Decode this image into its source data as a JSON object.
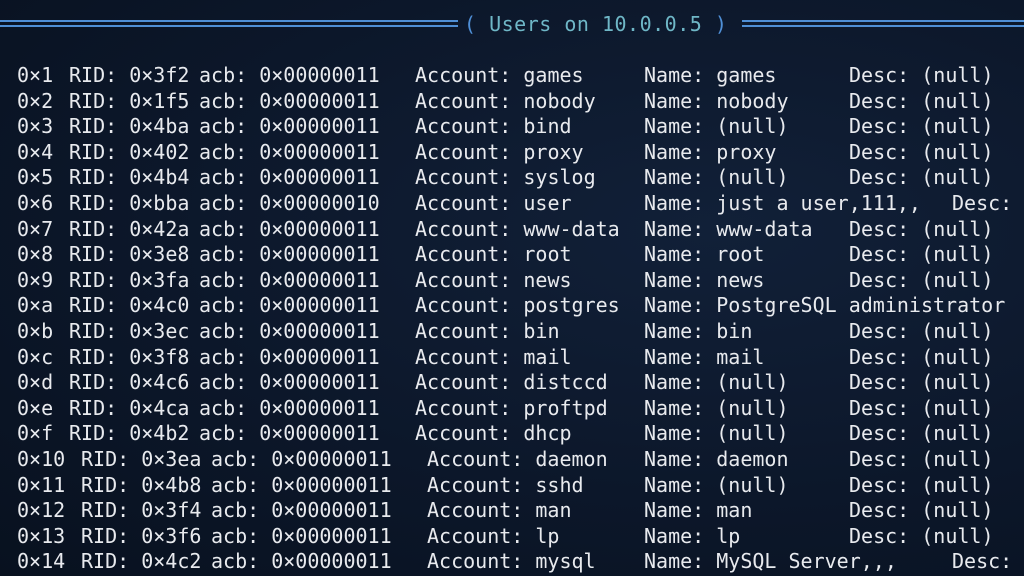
{
  "header": {
    "title": "Users on 10.0.0.5",
    "open": "(",
    "close": ")"
  },
  "rows": [
    {
      "idx": "0×1",
      "rid": "RID: 0×3f2",
      "acb": "acb: 0×00000011",
      "account": "Account: games",
      "name": "Name: games",
      "desc": "Desc: (null)"
    },
    {
      "idx": "0×2",
      "rid": "RID: 0×1f5",
      "acb": "acb: 0×00000011",
      "account": "Account: nobody",
      "name": "Name: nobody",
      "desc": "Desc: (null)"
    },
    {
      "idx": "0×3",
      "rid": "RID: 0×4ba",
      "acb": "acb: 0×00000011",
      "account": "Account: bind",
      "name": "Name: (null)",
      "desc": "Desc: (null)"
    },
    {
      "idx": "0×4",
      "rid": "RID: 0×402",
      "acb": "acb: 0×00000011",
      "account": "Account: proxy",
      "name": "Name: proxy",
      "desc": "Desc: (null)"
    },
    {
      "idx": "0×5",
      "rid": "RID: 0×4b4",
      "acb": "acb: 0×00000011",
      "account": "Account: syslog",
      "name": "Name: (null)",
      "desc": "Desc: (null)"
    },
    {
      "idx": "0×6",
      "rid": "RID: 0×bba",
      "acb": "acb: 0×00000010",
      "account": "Account: user",
      "name": "Name: just a user,111,,",
      "desc": "Desc:"
    },
    {
      "idx": "0×7",
      "rid": "RID: 0×42a",
      "acb": "acb: 0×00000011",
      "account": "Account: www-data",
      "name": "Name: www-data",
      "desc": "Desc: (null)"
    },
    {
      "idx": "0×8",
      "rid": "RID: 0×3e8",
      "acb": "acb: 0×00000011",
      "account": "Account: root",
      "name": "Name: root",
      "desc": "Desc: (null)"
    },
    {
      "idx": "0×9",
      "rid": "RID: 0×3fa",
      "acb": "acb: 0×00000011",
      "account": "Account: news",
      "name": "Name: news",
      "desc": "Desc: (null)"
    },
    {
      "idx": "0×a",
      "rid": "RID: 0×4c0",
      "acb": "acb: 0×00000011",
      "account": "Account: postgres",
      "name": "Name: PostgreSQL administrator",
      "desc": ""
    },
    {
      "idx": "0×b",
      "rid": "RID: 0×3ec",
      "acb": "acb: 0×00000011",
      "account": "Account: bin",
      "name": "Name: bin",
      "desc": "Desc: (null)"
    },
    {
      "idx": "0×c",
      "rid": "RID: 0×3f8",
      "acb": "acb: 0×00000011",
      "account": "Account: mail",
      "name": "Name: mail",
      "desc": "Desc: (null)"
    },
    {
      "idx": "0×d",
      "rid": "RID: 0×4c6",
      "acb": "acb: 0×00000011",
      "account": "Account: distccd",
      "name": "Name: (null)",
      "desc": "Desc: (null)"
    },
    {
      "idx": "0×e",
      "rid": "RID: 0×4ca",
      "acb": "acb: 0×00000011",
      "account": "Account: proftpd",
      "name": "Name: (null)",
      "desc": "Desc: (null)"
    },
    {
      "idx": "0×f",
      "rid": "RID: 0×4b2",
      "acb": "acb: 0×00000011",
      "account": "Account: dhcp",
      "name": "Name: (null)",
      "desc": "Desc: (null)"
    },
    {
      "idx": "0×10",
      "rid": "RID: 0×3ea",
      "acb": "acb: 0×00000011",
      "account": "Account: daemon",
      "name": "Name: daemon",
      "desc": "Desc: (null)"
    },
    {
      "idx": "0×11",
      "rid": "RID: 0×4b8",
      "acb": "acb: 0×00000011",
      "account": "Account: sshd",
      "name": "Name: (null)",
      "desc": "Desc: (null)"
    },
    {
      "idx": "0×12",
      "rid": "RID: 0×3f4",
      "acb": "acb: 0×00000011",
      "account": "Account: man",
      "name": "Name: man",
      "desc": "Desc: (null)"
    },
    {
      "idx": "0×13",
      "rid": "RID: 0×3f6",
      "acb": "acb: 0×00000011",
      "account": "Account: lp",
      "name": "Name: lp",
      "desc": "Desc: (null)"
    },
    {
      "idx": "0×14",
      "rid": "RID: 0×4c2",
      "acb": "acb: 0×00000011",
      "account": "Account: mysql",
      "name": "Name: MySQL Server,,,",
      "desc": "Desc:"
    }
  ]
}
